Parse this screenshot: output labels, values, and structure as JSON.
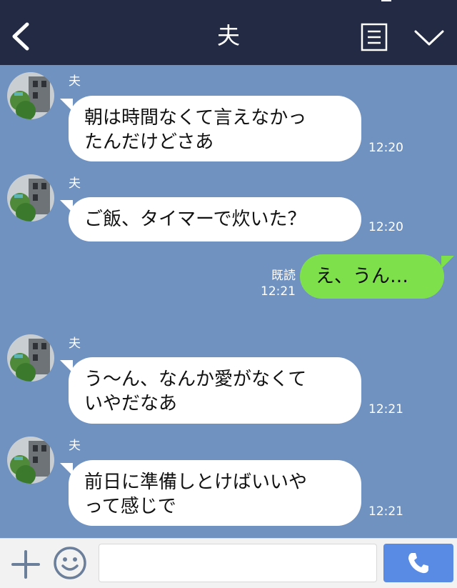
{
  "header": {
    "title": "夫"
  },
  "messages": [
    {
      "sender": "夫",
      "line1": "朝は時間なくて言えなかっ",
      "line2": "たんだけどさあ",
      "time": "12:20"
    },
    {
      "sender": "夫",
      "line1": "ご飯、タイマーで炊いた？",
      "time": "12:20"
    },
    {
      "sender": "夫",
      "line1": "う〜ん、なんか愛がなくて",
      "line2": "いやだなあ",
      "time": "12:21"
    },
    {
      "sender": "夫",
      "line1": "前日に準備しとけばいいや",
      "line2": "って感じで",
      "time": "12:21"
    }
  ],
  "my_message": {
    "text": "え、うん…",
    "read_label": "既読",
    "time": "12:21"
  },
  "input": {
    "value": "",
    "placeholder": ""
  },
  "colors": {
    "header_bg": "#222a44",
    "chat_bg": "#7092c1",
    "incoming_bubble": "#ffffff",
    "outgoing_bubble": "#7ee04a",
    "call_button": "#5a8be4"
  },
  "icons": [
    "back-chevron-icon",
    "menu-list-icon",
    "collapse-chevron-icon",
    "plus-icon",
    "emoji-icon",
    "phone-icon"
  ]
}
